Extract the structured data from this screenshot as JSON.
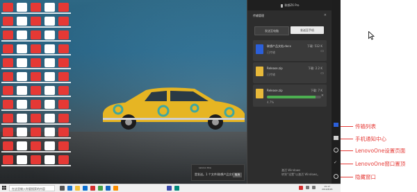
{
  "desktop": {
    "name": "Windows desktop"
  },
  "phone": {
    "title": "联想Z6 Pro"
  },
  "panel": {
    "title": "传输管理",
    "close": "×",
    "tabs": [
      {
        "label": "发送至电脑"
      },
      {
        "label": "发送至手机"
      }
    ],
    "transfers": [
      {
        "name": "联想产品文档.docx",
        "size": "下载: 512 K",
        "status": "已传输",
        "color": "#2b5fd9",
        "progress": null
      },
      {
        "name": "Release.zip",
        "size": "下载: 2.2 K",
        "status": "已传输",
        "color": "#e8b93a",
        "progress": null
      },
      {
        "name": "Release.zip",
        "size": "下载: 7 K",
        "status": "4.7%",
        "color": "#e8b93a",
        "progress": 0.9
      }
    ]
  },
  "toast": {
    "app": "Lenovo One",
    "message": "是发送。1 个文件(联想产品文档...",
    "button": "取消"
  },
  "activate": {
    "line1": "激活 Windows",
    "line2": "转到“设置”以激活 Windows。"
  },
  "taskbar": {
    "search_placeholder": "在这里输入你要搜索的内容",
    "time": "15:17",
    "date": "2019/8/26"
  },
  "annotations": [
    {
      "label": "传输列表"
    },
    {
      "label": "手机通知中心"
    },
    {
      "label": "LenovoOne设置页面"
    },
    {
      "label": "LenovoOne窗口置顶"
    },
    {
      "label": "隐藏窗口"
    }
  ],
  "colors": {
    "accent": "#e53935",
    "panel_bg": "#2d2d2d",
    "progress": "#4caf50"
  },
  "icons": [
    "transfer-list-icon",
    "notification-icon",
    "settings-icon",
    "pin-icon",
    "hide-window-icon",
    "mouse-cursor-icon"
  ]
}
